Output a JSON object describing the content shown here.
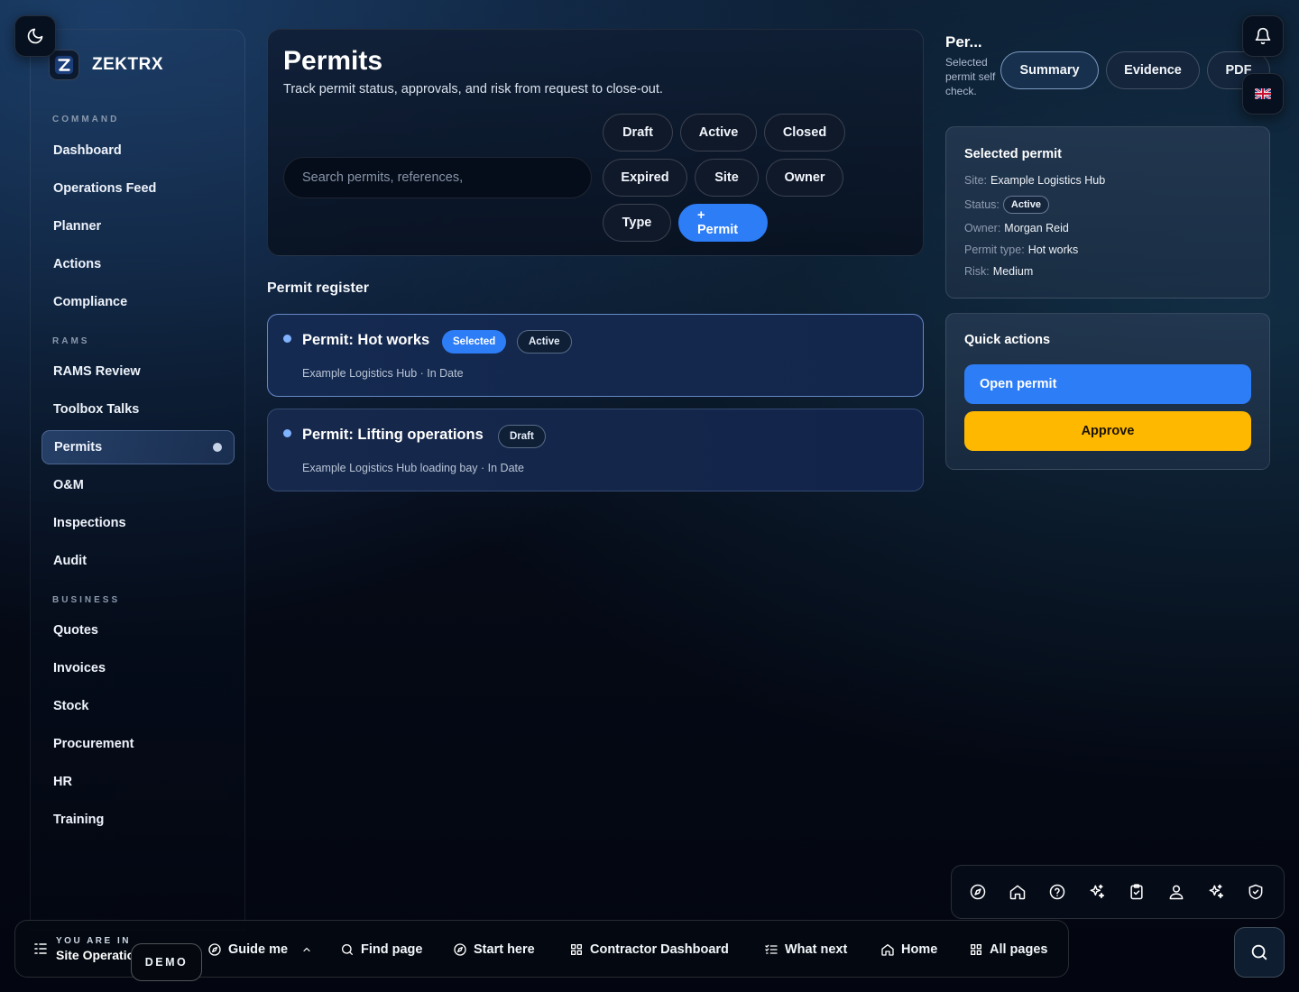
{
  "brand": {
    "name": "ZEKTRX"
  },
  "sidebar": {
    "sections": [
      "COMMAND",
      "RAMS",
      "BUSINESS"
    ],
    "command_items": [
      "Dashboard",
      "Operations Feed",
      "Planner",
      "Actions",
      "Compliance"
    ],
    "rams_items": [
      "RAMS Review",
      "Toolbox Talks",
      "Permits",
      "O&M",
      "Inspections",
      "Audit"
    ],
    "business_items": [
      "Quotes",
      "Invoices",
      "Stock",
      "Procurement",
      "HR",
      "Training"
    ],
    "active_item": "Permits"
  },
  "header": {
    "title": "Permits",
    "subtitle": "Track permit status, approvals, and risk from request to close-out.",
    "search_placeholder": "Search permits, references,",
    "filters": [
      "Draft",
      "Active",
      "Closed",
      "Expired",
      "Site",
      "Owner",
      "Type"
    ],
    "add_button": "+ Permit"
  },
  "register": {
    "heading": "Permit register",
    "permits": [
      {
        "title": "Permit: Hot works",
        "badges": [
          "Selected",
          "Active"
        ],
        "subtitle": "Example Logistics Hub · In Date"
      },
      {
        "title": "Permit: Lifting operations",
        "badges": [
          "Draft"
        ],
        "subtitle": "Example Logistics Hub loading bay · In Date"
      }
    ]
  },
  "right_panel": {
    "title": "Per...",
    "subtitle": "Selected permit self check.",
    "tabs": [
      "Summary",
      "Evidence",
      "PDF"
    ],
    "active_tab": "Summary",
    "selected_permit": {
      "heading": "Selected permit",
      "site_label": "Site:",
      "site_value": "Example Logistics Hub",
      "status_label": "Status:",
      "status_value": "Active",
      "owner_label": "Owner:",
      "owner_value": "Morgan Reid",
      "type_label": "Permit type:",
      "type_value": "Hot works",
      "risk_label": "Risk:",
      "risk_value": "Medium"
    },
    "quick_actions": {
      "heading": "Quick actions",
      "open_label": "Open permit",
      "approve_label": "Approve"
    }
  },
  "dock_icons": [
    "compass-icon",
    "home-icon",
    "help-icon",
    "sparkles-icon",
    "clipboard-icon",
    "user-pin-icon",
    "sparkles-icon",
    "shield-check-icon"
  ],
  "bottom_bar": {
    "location_label": "YOU ARE IN",
    "location_value": "Site Operations",
    "demo_badge": "DEMO",
    "items": [
      "Guide me",
      "Find page",
      "Start here",
      "Contractor Dashboard",
      "What next",
      "Home",
      "All pages"
    ]
  },
  "colors": {
    "accent": "#2d7df7",
    "approve": "#ffb800",
    "background": "#050a16"
  }
}
